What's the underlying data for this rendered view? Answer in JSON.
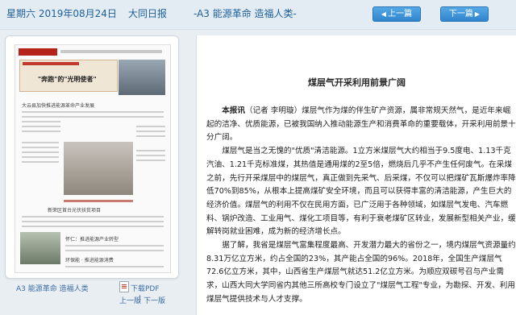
{
  "header": {
    "date": "星期六 2019年08月24日",
    "paper": "大同日报",
    "section": "-A3 能源革命 造福人类-",
    "prev_label": "上一篇",
    "next_label": "下一篇",
    "prev_arrow": "◀",
    "next_arrow": "▶"
  },
  "thumbnail": {
    "headline": "\"奔跑\"的\"光明使者\"",
    "sub1": "大云县加快推进能源革命产业发展",
    "sub2": "新荣区首台光伏扶贫项目",
    "sub3": "怀仁：推进能源产业转型",
    "sub4": "环保能 · 推进能源消费"
  },
  "page_footer": {
    "page_label": "A3 能源革命 造福人类",
    "download_label": "下载PDF",
    "prev_page": "上一版",
    "sep": "|",
    "next_page": "下一版"
  },
  "article": {
    "title": "煤层气开采利用前景广阔",
    "lead_bold": "本报讯",
    "lead_rest": "（记者 李明璇）煤层气作为煤的伴生矿产资源，属非常规天然气，是近年来崛起的洁净、优质能源，已被我国纳入推动能源生产和消费革命的重要载体，开采利用前景十分广阔。",
    "p2": "煤层气是当之无愧的\"优质\"清洁能源。1立方米煤层气大约相当于9.5度电、1.13千克汽油、1.21千克标准煤，其热值是通用煤的2至5倍，燃烧后几乎不产生任何废气。在采煤之前，先行开采煤层中的煤层气，真正做到先采气、后采煤，不仅可以把煤矿瓦斯爆炸率降低70%到85%，从根本上提高煤矿安全环境，而且可以获得丰富的清洁能源，产生巨大的经济价值。煤层气的利用不仅在民用方面，已广泛用于各种领域，如煤层气发电、汽车燃料、锅炉改造、工业用气、煤化工项目等，有利于衰老煤矿区转业，发展新型相关产业，缓解转岗就业困难，成为新的经济增长点。",
    "p3": "据了解，我省是煤层气富集程度最高、开发潜力最大的省份之一，境内煤层气资源量约8.31万亿立方米，约占全国的23%，其产能占全国的96%。2018年，全国生产煤层气72.6亿立方米，其中，山西省生产煤层气就达51.2亿立方米。为顺应双碳号召与产业需求，山西大同大学同省内其他三所高校专门设立了\"煤层气工程\"专业，为勘探、开发、利用煤层气提供技术与人才支撑。"
  },
  "colors": {
    "link_blue": "#1d5f9a",
    "button_blue": "#2f84cd",
    "page_bg": "#e9eef3"
  },
  "icons": [
    "pdf-icon",
    "arrow-left-icon",
    "arrow-right-icon"
  ]
}
